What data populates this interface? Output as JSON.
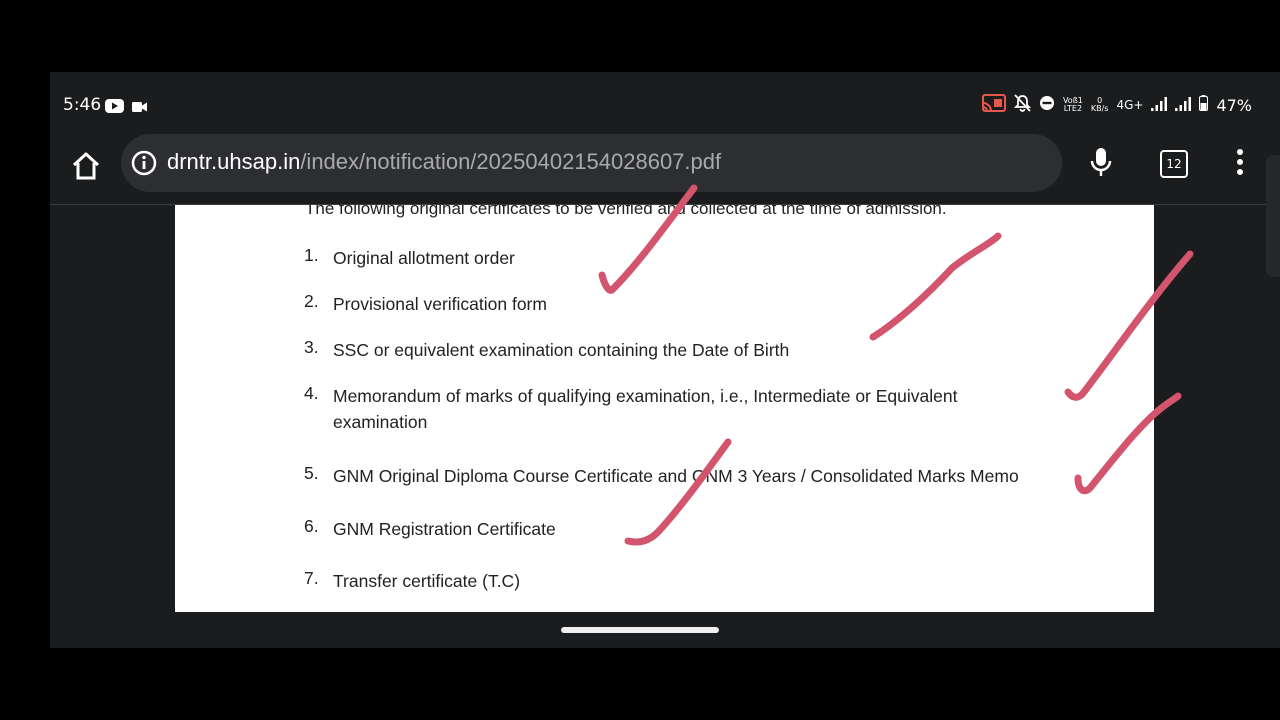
{
  "status_bar": {
    "time": "5:46",
    "left_icons": [
      "youtube-icon",
      "video-camera-icon"
    ],
    "right_icons": [
      "cast-icon",
      "bell-off-icon",
      "do-not-disturb-icon",
      "volte-icon",
      "data-speed-icon",
      "signal-icon",
      "signal-icon",
      "battery-icon"
    ],
    "volte_line1": "Voß1",
    "volte_line2": "LTE2",
    "speed_line1": "0",
    "speed_line2": "KB/s",
    "network": "4G+",
    "battery": "47%"
  },
  "toolbar": {
    "url_host": "drntr.uhsap.in",
    "url_path": "/index/notification/20250402154028607.pdf",
    "tab_count": "12"
  },
  "document": {
    "intro": "The following original certificates to be verified and collected at the time of admission.",
    "items": [
      {
        "num": "1.",
        "text": "Original allotment order"
      },
      {
        "num": "2.",
        "text": "Provisional verification form"
      },
      {
        "num": "3.",
        "text": "SSC or equivalent examination containing the Date of Birth"
      },
      {
        "num": "4.",
        "text": "Memorandum of marks of qualifying examination, i.e., Intermediate or Equivalent examination"
      },
      {
        "num": "5.",
        "text": "GNM Original Diploma Course Certificate and GNM 3 Years / Consolidated Marks Memo"
      },
      {
        "num": "6.",
        "text": "GNM Registration Certificate"
      },
      {
        "num": "7.",
        "text": "Transfer certificate (T.C)"
      }
    ]
  },
  "colors": {
    "background": "#000000",
    "chrome": "#1b1c1e",
    "url_bar": "#2d2e31",
    "annotation_ink": "#d2546d",
    "page": "#ffffff"
  }
}
